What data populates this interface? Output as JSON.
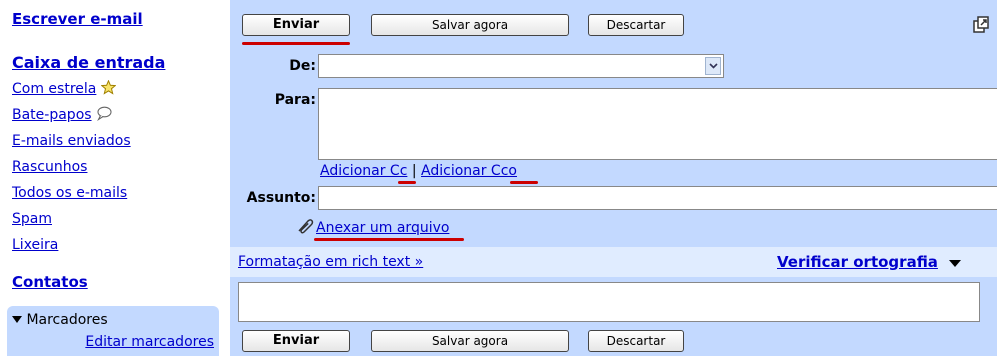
{
  "sidebar": {
    "compose": "Escrever e-mail",
    "items": [
      {
        "label": "Caixa de entrada",
        "icon": null
      },
      {
        "label": "Com estrela",
        "icon": "star-icon"
      },
      {
        "label": "Bate-papos",
        "icon": "chat-bubble-icon"
      },
      {
        "label": "E-mails enviados",
        "icon": null
      },
      {
        "label": "Rascunhos",
        "icon": null
      },
      {
        "label": "Todos os e-mails",
        "icon": null
      },
      {
        "label": "Spam",
        "icon": null
      },
      {
        "label": "Lixeira",
        "icon": null
      }
    ],
    "contacts": "Contatos",
    "labels_header": "Marcadores",
    "labels_edit": "Editar marcadores"
  },
  "toolbar": {
    "send": "Enviar",
    "save": "Salvar agora",
    "discard": "Descartar"
  },
  "compose": {
    "from_label": "De:",
    "from_value": "",
    "to_label": "Para:",
    "to_value": "",
    "add_cc": "Adicionar Cc",
    "separator": "|",
    "add_bcc": "Adicionar Cco",
    "subject_label": "Assunto:",
    "subject_value": "",
    "attach": "Anexar um arquivo",
    "rich_text": "Formatação em rich text »",
    "spellcheck": "Verificar ortografia"
  },
  "colors": {
    "panel": "#c3d9ff",
    "link": "#0000cc",
    "highlight_underline": "#cc0000"
  }
}
